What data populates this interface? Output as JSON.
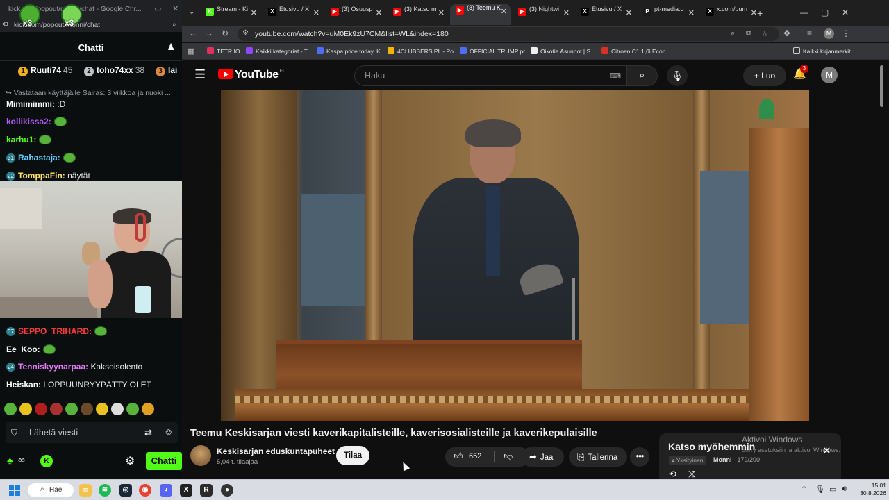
{
  "chat_window": {
    "title": "kick.com/popout/monni/chat - Google Chr...",
    "url": "kick.com/popout/monni/chat",
    "emote_counts": [
      "x3",
      "x3"
    ],
    "header_title": "Chatti",
    "leaderboard": [
      {
        "rank": "1",
        "name": "Ruuti74",
        "points": "45",
        "color": "#f2b01e"
      },
      {
        "rank": "2",
        "name": "toho74xx",
        "points": "38",
        "color": "#c0c4c8"
      },
      {
        "rank": "3",
        "name": "lai",
        "points": "",
        "color": "#d9893d"
      }
    ],
    "reply_line": "Vastataan käyttäjälle Sairas: 3 viikkoa ja nuoki ...",
    "messages_top": [
      {
        "user": "Mimimimmi:",
        "text": " :D",
        "color": "#ffffff",
        "badge": "",
        "emote": false
      },
      {
        "user": "kollikissa2:",
        "text": "",
        "color": "#b05cff",
        "badge": "",
        "emote": true
      },
      {
        "user": "karhu1:",
        "text": "",
        "color": "#53fc18",
        "badge": "",
        "emote": true
      },
      {
        "user": "Rahastaja:",
        "text": "",
        "color": "#5dd0ff",
        "badge": "31",
        "emote": true
      },
      {
        "user": "TomppaFin:",
        "text": " näytät",
        "color": "#ffe066",
        "badge": "22",
        "emote": false
      }
    ],
    "messages_bottom": [
      {
        "user": "SEPPO_TRIHARD:",
        "text": "",
        "color": "#ff3b3b",
        "badge": "37",
        "emote": true
      },
      {
        "user": "Ee_Koo:",
        "text": "",
        "color": "#ffffff",
        "badge": "",
        "emote": true
      },
      {
        "user": "Tenniskyynarpaa:",
        "text": " Kaksoisolento",
        "color": "#e879f9",
        "badge": "24",
        "emote": false
      },
      {
        "user": "Heiskan:",
        "text": " LOPPUUNRYYPÄTTY OLET",
        "color": "#ffffff",
        "badge": "",
        "emote": false
      }
    ],
    "input_placeholder": "Lähetä viesti",
    "send_button": "Chatti",
    "viewer_icon": "∞",
    "kick_logo": "K"
  },
  "browser": {
    "tabs": [
      {
        "title": "Stream - Ki",
        "fav": "K",
        "color": "#53fc18"
      },
      {
        "title": "Etusivu / X",
        "fav": "X",
        "color": "#000000"
      },
      {
        "title": "(3) Osuusp",
        "fav": "▶",
        "color": "#ff0000"
      },
      {
        "title": "(3) Katso m",
        "fav": "▶",
        "color": "#ff0000"
      },
      {
        "title": "(3) Teemu K",
        "fav": "▶",
        "color": "#ff0000",
        "active": true
      },
      {
        "title": "(3) Nightwi",
        "fav": "▶",
        "color": "#ff0000"
      },
      {
        "title": "Etusivu / X",
        "fav": "X",
        "color": "#000000"
      },
      {
        "title": "pt-media.o",
        "fav": "P",
        "color": "#1a1a1a"
      },
      {
        "title": "x.com/pum",
        "fav": "X",
        "color": "#000000"
      }
    ],
    "url": "youtube.com/watch?v=uM0Ek9zU7CM&list=WL&index=180",
    "profile_initial": "M",
    "bookmarks": [
      {
        "label": "TETR.IO",
        "color": "#e0315b"
      },
      {
        "label": "Kaikki kategoriat - T...",
        "color": "#9146ff"
      },
      {
        "label": "Kaspa price today, K...",
        "color": "#4c6ef5"
      },
      {
        "label": "4CLUBBERS.PL - Po...",
        "color": "#f5b400"
      },
      {
        "label": "OFFICIAL TRUMP pr...",
        "color": "#4c6ef5"
      },
      {
        "label": "Oikotie Asunnot | S...",
        "color": "#eeeeee"
      },
      {
        "label": "Citroen C1 1,0i Econ...",
        "color": "#d93025"
      }
    ],
    "all_bookmarks": "Kaikki kirjanmerkit"
  },
  "youtube": {
    "logo_text": "YouTube",
    "logo_region": "FI",
    "search_placeholder": "Haku",
    "create_label": "Luo",
    "notifications": "3",
    "avatar_initial": "M",
    "video_title": "Teemu Keskisarjan viesti kaverikapitalisteille, kaverisosialisteille ja kaverikepulaisille",
    "channel_name": "Keskisarjan eduskuntapuheet",
    "subscribers": "5,04 t. tilaajaa",
    "subscribe_label": "Tilaa",
    "likes": "652",
    "share_label": "Jaa",
    "save_label": "Tallenna",
    "watch_later": {
      "title": "Katso myöhemmin",
      "privacy": "Yksityinen",
      "owner": "Monni",
      "position": "179/200"
    },
    "activate_windows": "Aktivoi Windows",
    "activate_windows_sub": "Siirry asetuksiin ja aktivoi Windows."
  },
  "taskbar": {
    "search_label": "Hae",
    "time": "15.01",
    "date": "30.8.2026"
  }
}
